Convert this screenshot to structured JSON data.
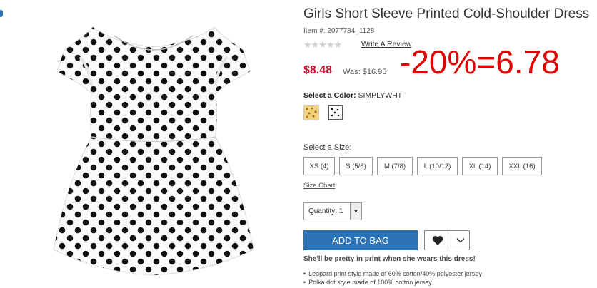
{
  "product": {
    "title": "Girls Short Sleeve Printed Cold-Shoulder Dress",
    "item_number": "Item #: 2077784_1128",
    "rating_stars": "★★★★★",
    "write_review": "Write A Review",
    "price": "$8.48",
    "was_price": "Was: $16.95",
    "discount_note": "-20%=6.78",
    "color_label": "Select a Color:",
    "selected_color": "SIMPLYWHT",
    "size_label": "Select a Size:",
    "sizes": [
      "XS (4)",
      "S (5/6)",
      "M (7/8)",
      "L (10/12)",
      "XL (14)",
      "XXL (16)"
    ],
    "size_chart": "Size Chart",
    "quantity_label": "Quantity: 1",
    "add_to_bag": "ADD TO BAG",
    "tagline": "She'll be pretty in print when she wears this dress!",
    "bullets": [
      "Leopard print style made of 60% cotton/40% polyester jersey",
      "Polka dot style made of 100% cotton jersey"
    ]
  },
  "colors": {
    "accent": "#2b73b6",
    "price": "#c8102e",
    "discount": "#e00000"
  },
  "icons": {
    "wishlist": "heart-icon",
    "dropdown": "chevron-down-icon"
  }
}
